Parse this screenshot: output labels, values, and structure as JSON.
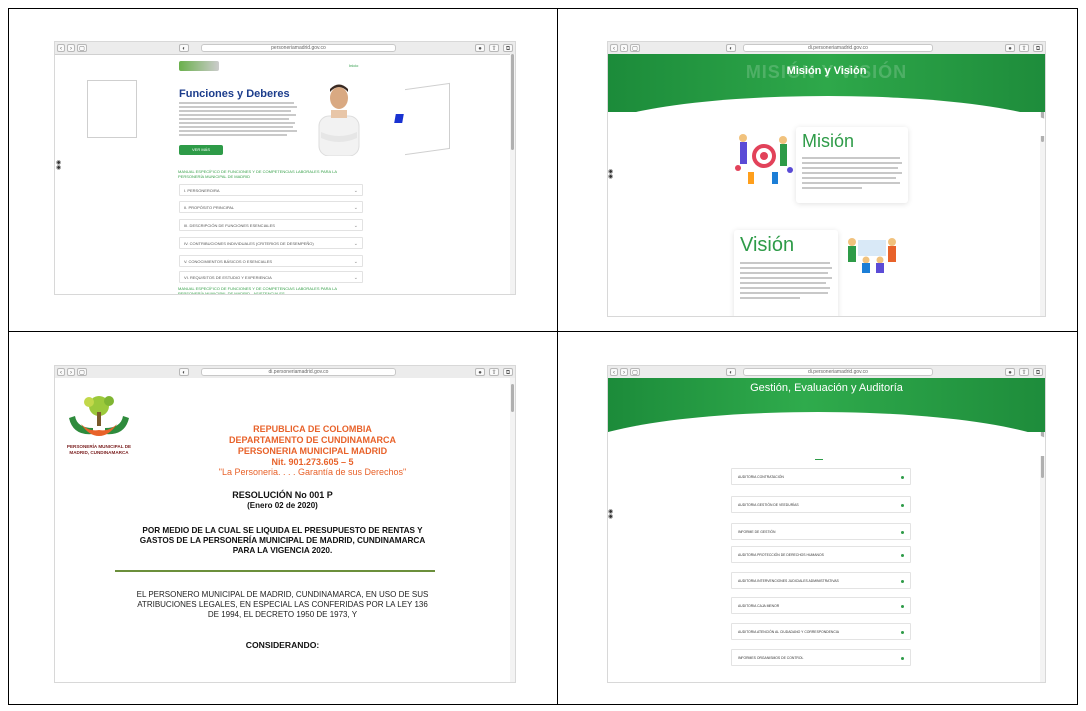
{
  "browser": {
    "url": "personeriamadrid.gov.co",
    "url_short": "di.personeriamadrid.gov.co",
    "nav_back": "‹",
    "nav_forward": "›",
    "shield": "◐"
  },
  "panel1": {
    "menu_label": "Inicio",
    "title": "Funciones y Deberes",
    "button": "VER MÁS",
    "heading1": "MANUAL ESPECÍFICO DE FUNCIONES Y DE COMPETENCIAS LABORALES PARA LA PERSONERÍA MUNICIPAL DE MADRID",
    "items": [
      "I. PERSONERO/RA",
      "II. PROPÓSITO PRINCIPAL",
      "III. DESCRIPCIÓN DE FUNCIONES ESENCIALES",
      "IV. CONTRIBUCIONES INDIVIDUALES (CRITERIOS DE DESEMPEÑO)",
      "V. CONOCIMIENTOS BÁSICOS O ESENCIALES",
      "VI. REQUISITOS DE ESTUDIO Y EXPERIENCIA"
    ],
    "heading2": "MANUAL ESPECÍFICO DE FUNCIONES Y DE COMPETENCIAS LABORALES PARA LA PERSONERÍA MUNICIPAL DE MADRID - ASISTENCIALES"
  },
  "panel2": {
    "ghost": "MISIÓN Y VISIÓN",
    "title": "Misión y Visión",
    "mision": "Misión",
    "vision": "Visión"
  },
  "panel3": {
    "h1": "REPUBLICA DE COLOMBIA",
    "h2": "DEPARTAMENTO DE CUNDINAMARCA",
    "h3": "PERSONERIA MUNICIPAL MADRID",
    "h4": "Nit. 901.273.605 – 5",
    "h5": "\"La Personeria. . . . Garantía de sus Derechos\"",
    "logo_line1": "PERSONERÍA MUNICIPAL DE",
    "logo_line2": "MADRID, CUNDINAMARCA",
    "res1": "RESOLUCIÓN  No 001  P",
    "res2": "(Enero 02 de 2020)",
    "sub1": "POR MEDIO DE LA CUAL SE LIQUIDA EL PRESUPUESTO DE RENTAS Y",
    "sub2": "GASTOS DE LA PERSONERÍA MUNICIPAL DE MADRID, CUNDINAMARCA",
    "sub3": "PARA LA VIGENCIA 2020.",
    "body1": "EL PERSONERO MUNICIPAL DE MADRID, CUNDINAMARCA, EN USO DE SUS",
    "body2": "ATRIBUCIONES LEGALES, EN ESPECIAL LAS CONFERIDAS POR LA LEY 136",
    "body3": "DE 1994, EL DECRETO 1950 DE 1973, Y",
    "considerando": "CONSIDERANDO:"
  },
  "panel4": {
    "title": "Gestión, Evaluación y Auditoría",
    "items": [
      "Auditoria Contratación",
      "Auditoria Gestión de Veedurías",
      "Informe de Gestión",
      "Auditoria Protección de Derechos Humanos",
      "Auditoria Intervenciones Judiciales Administrativas",
      "Auditoria Caja Menor",
      "Auditoria Atención al Ciudadano y Correspondencia",
      "Informes Organismos de Control"
    ]
  },
  "colors": {
    "green": "#2e9b48",
    "orange": "#e8622a",
    "blue": "#1c3d8c"
  }
}
